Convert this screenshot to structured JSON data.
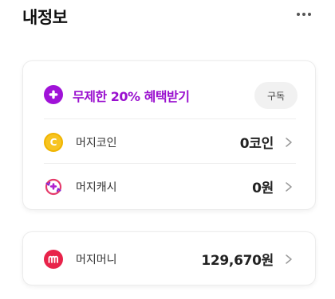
{
  "header": {
    "title": "내정보",
    "more_icon": "more-horizontal-icon"
  },
  "membership": {
    "promo_label": "무제한 20% 혜택받기",
    "promo_icon": "plus-circle-icon",
    "subscribe_label": "구독",
    "accent_color": "#9a10cf"
  },
  "wallet": {
    "coin": {
      "icon": "coin-icon",
      "icon_letter": "C",
      "label": "머지코인",
      "value": "0코인"
    },
    "cash": {
      "icon": "cash-icon",
      "label": "머지캐시",
      "value": "0원"
    },
    "money": {
      "icon": "money-icon",
      "label": "머지머니",
      "value": "129,670원"
    }
  }
}
